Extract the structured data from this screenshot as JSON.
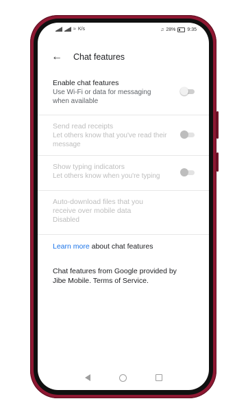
{
  "statusbar": {
    "left_speed": "K/s",
    "battery": "28%",
    "time": "9:35"
  },
  "appbar": {
    "title": "Chat features"
  },
  "settings": [
    {
      "title": "Enable chat features",
      "subtitle": "Use Wi-Fi or data for messaging when available",
      "enabled": true,
      "toggle_on": false
    },
    {
      "title": "Send read receipts",
      "subtitle": "Let others know that you've read their message",
      "enabled": false,
      "toggle_on": false
    },
    {
      "title": "Show typing indicators",
      "subtitle": "Let others know when you're typing",
      "enabled": false,
      "toggle_on": false
    },
    {
      "title": "Auto-download files that you receive over mobile data",
      "subtitle": "Disabled",
      "enabled": false
    }
  ],
  "learn_more": {
    "link": "Learn more",
    "rest": " about chat features"
  },
  "footer": "Chat features from Google provided by Jibe Mobile. Terms of Service.",
  "colors": {
    "phone_frame": "#8e1832",
    "annotation_arrow": "#d32f2f",
    "link": "#1a73e8"
  }
}
